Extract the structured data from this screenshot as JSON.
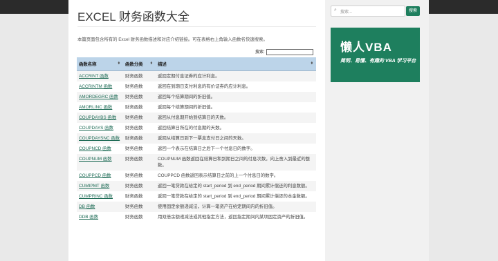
{
  "page": {
    "title": "EXCEL 财务函数大全",
    "intro": "本篇页面包含所有的 Excel 财务函数描述和对应介绍链接。可在表格右上角输入函数名快速搜索。"
  },
  "table_search": {
    "label": "搜索:",
    "value": ""
  },
  "table": {
    "headers": [
      "函数名称",
      "函数分类",
      "描述"
    ],
    "rows": [
      {
        "name": "ACCRINT 函数",
        "category": "财务函数",
        "desc": "返回定期付息证券的应计利息。"
      },
      {
        "name": "ACCRINTM 函数",
        "category": "财务函数",
        "desc": "返回在到期日支付利息的有价证券的应计利息。"
      },
      {
        "name": "AMORDEGRC 函数",
        "category": "财务函数",
        "desc": "返回每个结算期间的折旧值。"
      },
      {
        "name": "AMORLINC 函数",
        "category": "财务函数",
        "desc": "返回每个结算期间的折旧值。"
      },
      {
        "name": "COUPDAYBS 函数",
        "category": "财务函数",
        "desc": "返回从付息期开始到结算日的天数。"
      },
      {
        "name": "COUPDAYS 函数",
        "category": "财务函数",
        "desc": "返回结算日所在的付息期的天数。"
      },
      {
        "name": "COUPDAYSNC 函数",
        "category": "财务函数",
        "desc": "返回从结算日到下一票息支付日之间的天数。"
      },
      {
        "name": "COUPNCD 函数",
        "category": "财务函数",
        "desc": "返回一个表示在结算日之后下一个付息日的数字。"
      },
      {
        "name": "COUPNUM 函数",
        "category": "财务函数",
        "desc": "COUPNUM 函数返回在结算日和到期日之间的付息次数，向上舍入到最近的整数。"
      },
      {
        "name": "COUPPCD 函数",
        "category": "财务函数",
        "desc": "COUPPCD 函数返回表示结算日之前的上一个付息日的数字。"
      },
      {
        "name": "CUMIPMT 函数",
        "category": "财务函数",
        "desc": "返回一笔贷款在给定的 start_period 到 end_period 期间累计偿还的利息数额。"
      },
      {
        "name": "CUMPRINC 函数",
        "category": "财务函数",
        "desc": "返回一笔贷款在给定的 start_period 到 end_period 期间累计偿还的本金数额。"
      },
      {
        "name": "DB 函数",
        "category": "财务函数",
        "desc": "使用固定余额递减法，计算一笔资产在给定期间内的折旧值。"
      },
      {
        "name": "DDB 函数",
        "category": "财务函数",
        "desc": "用双倍余额递减法或其他指定方法，返回指定期间内某项固定资产的折旧值。"
      }
    ]
  },
  "sidebar": {
    "search_placeholder": "搜索...",
    "search_button": "搜索",
    "ad_title": "懒人VBA",
    "ad_subtitle": "简明、易懂、有趣的 VBA 学习平台"
  }
}
